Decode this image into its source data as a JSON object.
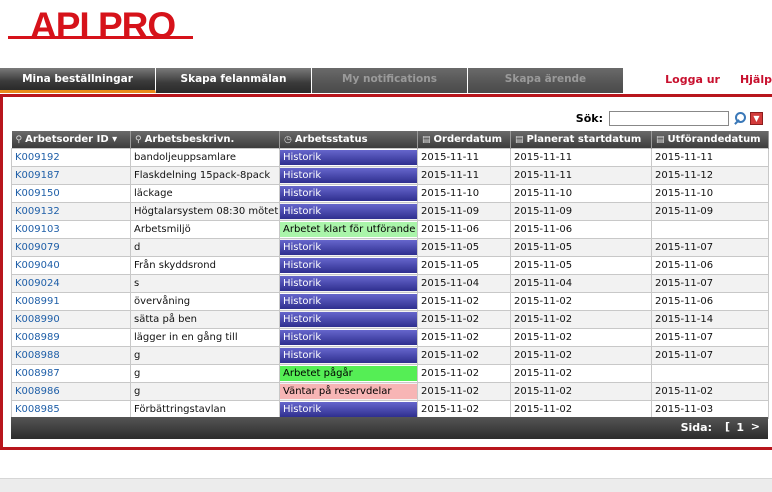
{
  "logo": {
    "text": "API PRO"
  },
  "nav": {
    "tabs": [
      "Mina beställningar",
      "Skapa felanmälan",
      "My notifications",
      "Skapa ärende"
    ],
    "logout": "Logga ur",
    "help": "Hjälp"
  },
  "search": {
    "label": "Sök:",
    "value": ""
  },
  "table": {
    "headers": [
      "Arbetsorder ID",
      "Arbetsbeskrivn.",
      "Arbetsstatus",
      "Orderdatum",
      "Planerat startdatum",
      "Utförandedatum"
    ],
    "rows": [
      [
        "K009192",
        "bandoljeuppsamlare",
        "Historik",
        "2015-11-11",
        "2015-11-11",
        "2015-11-11"
      ],
      [
        "K009187",
        "Flaskdelning 15pack-8pack",
        "Historik",
        "2015-11-11",
        "2015-11-11",
        "2015-11-12"
      ],
      [
        "K009150",
        "läckage",
        "Historik",
        "2015-11-10",
        "2015-11-10",
        "2015-11-10"
      ],
      [
        "K009132",
        "Högtalarsystem 08:30 mötet",
        "Historik",
        "2015-11-09",
        "2015-11-09",
        "2015-11-09"
      ],
      [
        "K009103",
        "Arbetsmiljö",
        "Arbetet klart för utförande",
        "2015-11-06",
        "2015-11-06",
        ""
      ],
      [
        "K009079",
        "d",
        "Historik",
        "2015-11-05",
        "2015-11-05",
        "2015-11-07"
      ],
      [
        "K009040",
        "Från skyddsrond",
        "Historik",
        "2015-11-05",
        "2015-11-05",
        "2015-11-06"
      ],
      [
        "K009024",
        "s",
        "Historik",
        "2015-11-04",
        "2015-11-04",
        "2015-11-07"
      ],
      [
        "K008991",
        "övervåning",
        "Historik",
        "2015-11-02",
        "2015-11-02",
        "2015-11-06"
      ],
      [
        "K008990",
        "sätta på ben",
        "Historik",
        "2015-11-02",
        "2015-11-02",
        "2015-11-14"
      ],
      [
        "K008989",
        "lägger in en gång till",
        "Historik",
        "2015-11-02",
        "2015-11-02",
        "2015-11-07"
      ],
      [
        "K008988",
        "g",
        "Historik",
        "2015-11-02",
        "2015-11-02",
        "2015-11-07"
      ],
      [
        "K008987",
        "g",
        "Arbetet pågår",
        "2015-11-02",
        "2015-11-02",
        ""
      ],
      [
        "K008986",
        "g",
        "Väntar på reservdelar",
        "2015-11-02",
        "2015-11-02",
        "2015-11-02"
      ],
      [
        "K008985",
        "Förbättringstavlan",
        "Historik",
        "2015-11-02",
        "2015-11-02",
        "2015-11-03"
      ]
    ],
    "status_styles": [
      "h",
      "h",
      "h",
      "h",
      "k",
      "h",
      "h",
      "h",
      "h",
      "h",
      "h",
      "h",
      "p",
      "r",
      "h"
    ]
  },
  "pager": {
    "label": "Sida:",
    "prev": "[",
    "page": "1",
    "next": ">"
  },
  "colors": {
    "brand": "#d6121a",
    "accent": "#e88a1a",
    "link": "#1f5fa8"
  }
}
